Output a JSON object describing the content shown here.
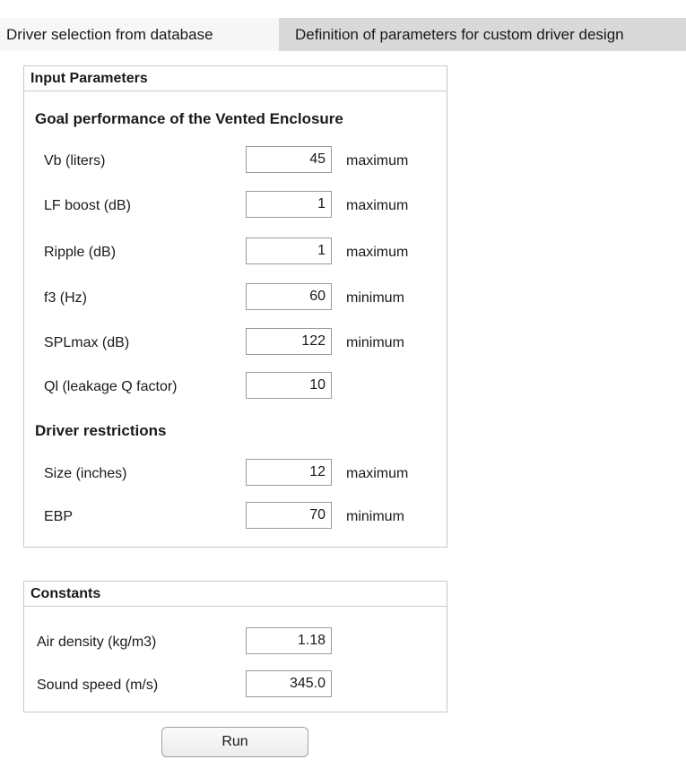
{
  "tabs": [
    {
      "label": "Driver selection from database",
      "active": true
    },
    {
      "label": "Definition of parameters for custom driver design",
      "active": false
    }
  ],
  "input_parameters": {
    "title": "Input Parameters",
    "goal_heading": "Goal performance of the Vented Enclosure",
    "goal_rows": [
      {
        "label": "Vb (liters)",
        "value": "45",
        "qualifier": "maximum"
      },
      {
        "label": "LF boost (dB)",
        "value": "1",
        "qualifier": "maximum"
      },
      {
        "label": "Ripple (dB)",
        "value": "1",
        "qualifier": "maximum"
      },
      {
        "label": "f3 (Hz)",
        "value": "60",
        "qualifier": "minimum"
      },
      {
        "label": "SPLmax (dB)",
        "value": "122",
        "qualifier": "minimum"
      },
      {
        "label": "Ql (leakage Q factor)",
        "value": "10",
        "qualifier": ""
      }
    ],
    "driver_heading": "Driver restrictions",
    "driver_rows": [
      {
        "label": "Size (inches)",
        "value": "12",
        "qualifier": "maximum"
      },
      {
        "label": "EBP",
        "value": "70",
        "qualifier": "minimum"
      }
    ]
  },
  "constants": {
    "title": "Constants",
    "rows": [
      {
        "label": "Air density (kg/m3)",
        "value": "1.18"
      },
      {
        "label": "Sound speed (m/s)",
        "value": "345.0"
      }
    ]
  },
  "run_label": "Run"
}
